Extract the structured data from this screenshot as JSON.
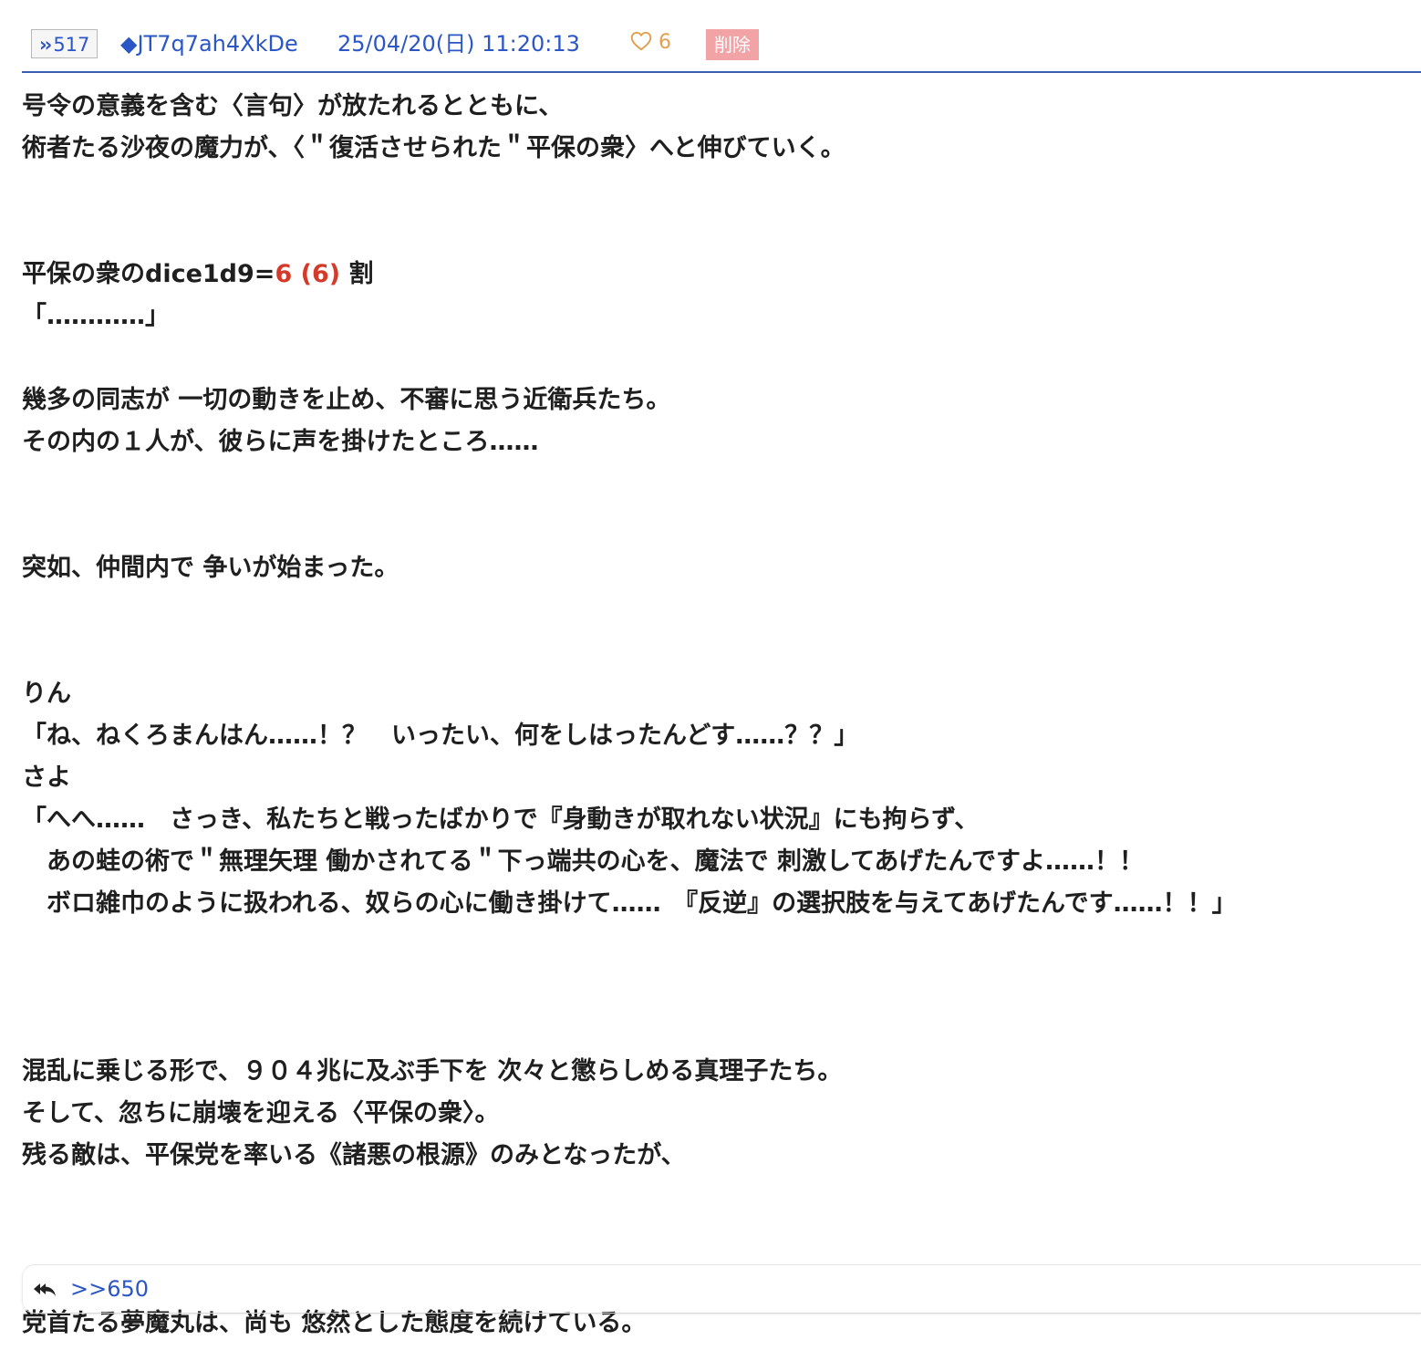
{
  "header": {
    "res_number": "517",
    "poster_id": "◆JT7q7ah4XkDe",
    "date": "25/04/20(日) 11:20:13",
    "like_count": "6",
    "delete_label": "削除"
  },
  "body": {
    "l1": "号令の意義を含む〈言句〉が放たれるとともに、",
    "l2": "術者たる沙夜の魔力が、〈＂復活させられた＂平保の衆〉へと伸びていく。",
    "dice_prefix": "平保の衆のdice1d9=",
    "dice_result": "6 (6)",
    "dice_suffix": " 割",
    "l4": "「…………」",
    "l5": "幾多の同志が 一切の動きを止め、不審に思う近衛兵たち。",
    "l6": "その内の１人が、彼らに声を掛けたところ……",
    "l7": "突如、仲間内で 争いが始まった。",
    "l8": "りん",
    "l9": "「ね、ねくろまんはん……！？　いったい、何をしはったんどす……？？」",
    "l10": "さよ",
    "l11": "「へへ……　さっき、私たちと戦ったばかりで『身動きが取れない状況』にも拘らず、",
    "l12": "　あの蛙の術で＂無理矢理 働かされてる＂下っ端共の心を、魔法で 刺激してあげたんですよ……！！",
    "l13": "　ボロ雑巾のように扱われる、奴らの心に働き掛けて……　『反逆』の選択肢を与えてあげたんです……！！」",
    "l14": "混乱に乗じる形で、９０４兆に及ぶ手下を 次々と懲らしめる真理子たち。",
    "l15": "そして、忽ちに崩壊を迎える〈平保の衆〉。",
    "l16": "残る敵は、平保党を率いる《諸悪の根源》のみとなったが、",
    "l17": "党首たる夢魔丸は、尚も 悠然とした態度を続けている。"
  },
  "footer": {
    "reply_link": ">>650",
    "reply_icon": "reply-all-icon"
  },
  "colors": {
    "link": "#2a56c6",
    "dice": "#d43a2a",
    "like": "#e0a050",
    "delete_bg": "#f2a3a6",
    "header_rule": "#3b5fb0"
  }
}
